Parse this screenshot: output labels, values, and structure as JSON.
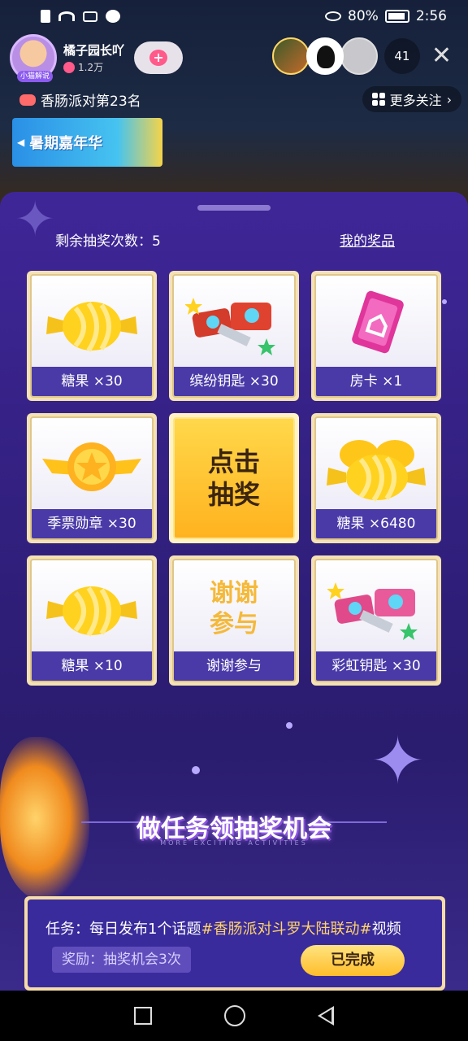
{
  "status_bar": {
    "battery": "80%",
    "time": "2:56"
  },
  "host": {
    "name": "橘子园长吖",
    "fans": "1.2万",
    "avatar_tag": "小猫解说"
  },
  "viewers": {
    "count": "41"
  },
  "rank": {
    "text": "香肠派对第23名"
  },
  "more_follow": {
    "label": "更多关注",
    "chevron": "›"
  },
  "banner": {
    "text": "暑期嘉年华"
  },
  "lottery": {
    "remaining_label": "剩余抽奖次数：",
    "remaining_count": "5",
    "my_prizes": "我的奖品",
    "draw_button": {
      "line1": "点击",
      "line2": "抽奖"
    },
    "thanks_big": {
      "line1": "谢谢",
      "line2": "参与"
    },
    "prizes": [
      {
        "label": "糖果 ×30",
        "icon": "candy-icon"
      },
      {
        "label": "缤纷钥匙 ×30",
        "icon": "colorful-key-icon"
      },
      {
        "label": "房卡 ×1",
        "icon": "room-card-icon"
      },
      {
        "label": "季票勋章 ×30",
        "icon": "season-medal-icon"
      },
      {
        "label": "糖果 ×6480",
        "icon": "candy-pile-icon"
      },
      {
        "label": "糖果 ×10",
        "icon": "candy-icon"
      },
      {
        "label": "谢谢参与",
        "icon": "thanks-icon"
      },
      {
        "label": "彩虹钥匙 ×30",
        "icon": "rainbow-key-icon"
      }
    ]
  },
  "tasks": {
    "title": "做任务领抽奖机会",
    "subtitle": "MORE EXCITING ACTIVITIES",
    "task_prefix": "任务：每日发布1个话题",
    "task_tag": "#香肠派对斗罗大陆联动#",
    "task_suffix": "视频",
    "reward": "奖励：抽奖机会3次",
    "done_label": "已完成"
  },
  "colors": {
    "panel_bg": "#3f2698",
    "label_bg": "#4a3aa8",
    "gold": "#ffbe2a"
  }
}
